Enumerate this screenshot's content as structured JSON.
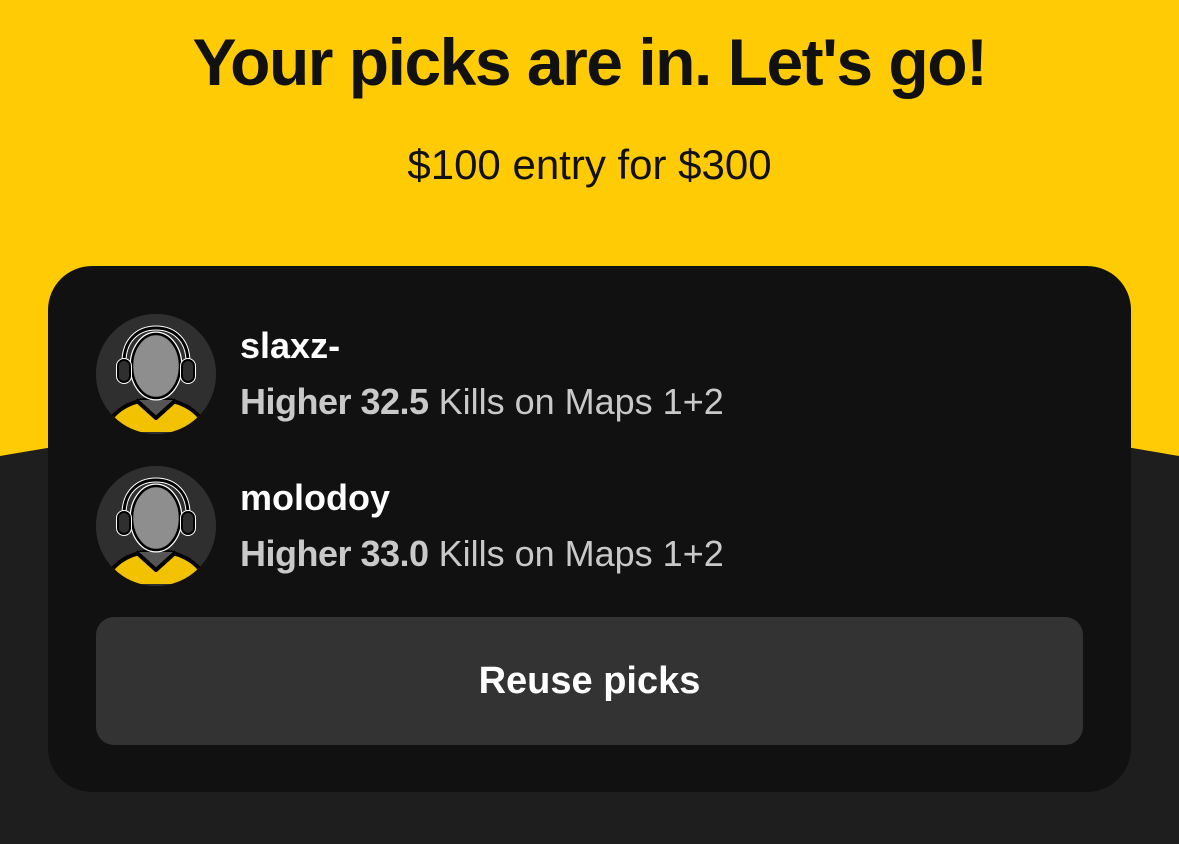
{
  "colors": {
    "accent_yellow": "#FFCB05",
    "dark_background": "#1E1E1E",
    "card_background": "#111111",
    "button_background": "#333333"
  },
  "header": {
    "title": "Your picks are in. Let's go!",
    "entry_text": "$100 entry for $300"
  },
  "picks": [
    {
      "player": "slaxz-",
      "direction": "Higher 32.5",
      "stat": "Kills on Maps 1+2",
      "avatar_icon": "player-silhouette-icon"
    },
    {
      "player": "molodoy",
      "direction": "Higher 33.0",
      "stat": "Kills on Maps 1+2",
      "avatar_icon": "player-silhouette-icon"
    }
  ],
  "actions": {
    "reuse_label": "Reuse picks"
  }
}
